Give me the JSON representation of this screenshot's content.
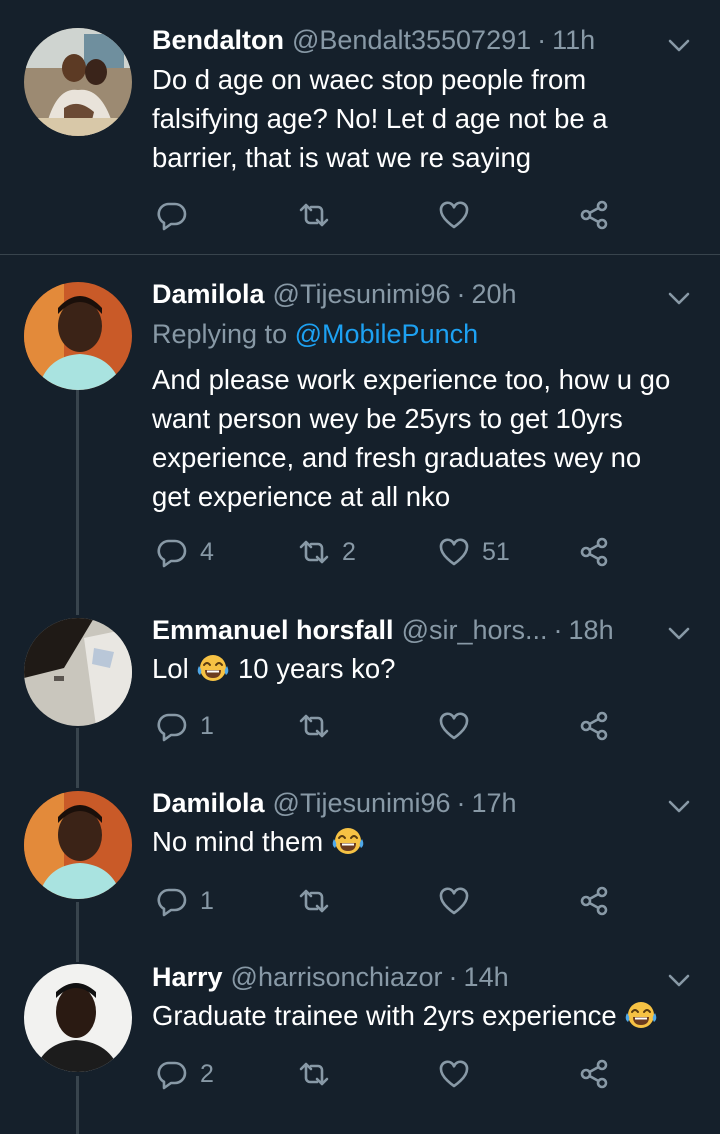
{
  "tweets": [
    {
      "name": "Bendalton",
      "handle": "@Bendalt35507291",
      "time": "11h",
      "text": "Do d age on waec stop people from falsifying age? No! Let d age not be a barrier, that is wat we re saying",
      "replies": "",
      "retweets": "",
      "likes": ""
    },
    {
      "name": "Damilola",
      "handle": "@Tijesunimi96",
      "time": "20h",
      "replying_label": "Replying to",
      "replying_to": "@MobilePunch",
      "text": "And please work experience too, how u go want person wey be 25yrs to get 10yrs experience, and fresh graduates wey no get experience at all nko",
      "replies": "4",
      "retweets": "2",
      "likes": "51"
    },
    {
      "name": "Emmanuel horsfall",
      "handle": "@sir_hors...",
      "time": "18h",
      "text_before": "Lol",
      "text_after": "10 years ko?",
      "replies": "1",
      "retweets": "",
      "likes": ""
    },
    {
      "name": "Damilola",
      "handle": "@Tijesunimi96",
      "time": "17h",
      "text": "No mind them",
      "replies": "1",
      "retweets": "",
      "likes": ""
    },
    {
      "name": "Harry",
      "handle": "@harrisonchiazor",
      "time": "14h",
      "text": "Graduate trainee with 2yrs experience",
      "replies": "2",
      "retweets": "",
      "likes": ""
    }
  ],
  "icons": {
    "reply": "reply-icon",
    "retweet": "retweet-icon",
    "like": "heart-icon",
    "share": "share-icon",
    "more": "chevron-down-icon",
    "emoji": "face-with-tears-of-joy-icon"
  },
  "colors": {
    "background": "#15202b",
    "secondary_text": "#8899a6",
    "mention": "#1da1f2",
    "divider": "#38444d"
  }
}
